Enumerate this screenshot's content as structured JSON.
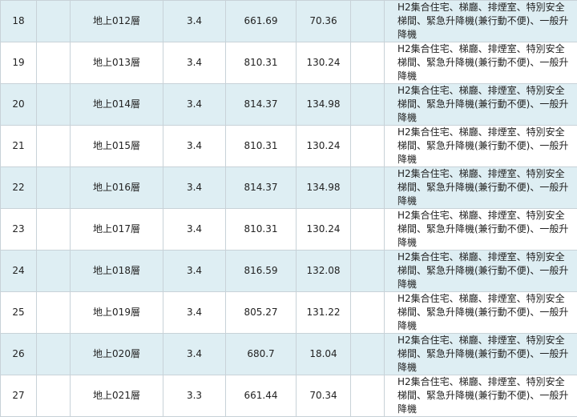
{
  "table": {
    "rows": [
      {
        "no": "18",
        "floor": "地上012層",
        "height": "3.4",
        "area": "661.69",
        "area2": "70.36",
        "use": "H2集合住宅、梯廳、排煙室、特別安全梯間、緊急升降機(兼行動不便)、一般升降機"
      },
      {
        "no": "19",
        "floor": "地上013層",
        "height": "3.4",
        "area": "810.31",
        "area2": "130.24",
        "use": "H2集合住宅、梯廳、排煙室、特別安全梯間、緊急升降機(兼行動不便)、一般升降機"
      },
      {
        "no": "20",
        "floor": "地上014層",
        "height": "3.4",
        "area": "814.37",
        "area2": "134.98",
        "use": "H2集合住宅、梯廳、排煙室、特別安全梯間、緊急升降機(兼行動不便)、一般升降機"
      },
      {
        "no": "21",
        "floor": "地上015層",
        "height": "3.4",
        "area": "810.31",
        "area2": "130.24",
        "use": "H2集合住宅、梯廳、排煙室、特別安全梯間、緊急升降機(兼行動不便)、一般升降機"
      },
      {
        "no": "22",
        "floor": "地上016層",
        "height": "3.4",
        "area": "814.37",
        "area2": "134.98",
        "use": "H2集合住宅、梯廳、排煙室、特別安全梯間、緊急升降機(兼行動不便)、一般升降機"
      },
      {
        "no": "23",
        "floor": "地上017層",
        "height": "3.4",
        "area": "810.31",
        "area2": "130.24",
        "use": "H2集合住宅、梯廳、排煙室、特別安全梯間、緊急升降機(兼行動不便)、一般升降機"
      },
      {
        "no": "24",
        "floor": "地上018層",
        "height": "3.4",
        "area": "816.59",
        "area2": "132.08",
        "use": "H2集合住宅、梯廳、排煙室、特別安全梯間、緊急升降機(兼行動不便)、一般升降機"
      },
      {
        "no": "25",
        "floor": "地上019層",
        "height": "3.4",
        "area": "805.27",
        "area2": "131.22",
        "use": "H2集合住宅、梯廳、排煙室、特別安全梯間、緊急升降機(兼行動不便)、一般升降機"
      },
      {
        "no": "26",
        "floor": "地上020層",
        "height": "3.4",
        "area": "680.7",
        "area2": "18.04",
        "use": "H2集合住宅、梯廳、排煙室、特別安全梯間、緊急升降機(兼行動不便)、一般升降機"
      },
      {
        "no": "27",
        "floor": "地上021層",
        "height": "3.3",
        "area": "661.44",
        "area2": "70.34",
        "use": "H2集合住宅、梯廳、排煙室、特別安全梯間、緊急升降機(兼行動不便)、一般升降機"
      }
    ]
  }
}
